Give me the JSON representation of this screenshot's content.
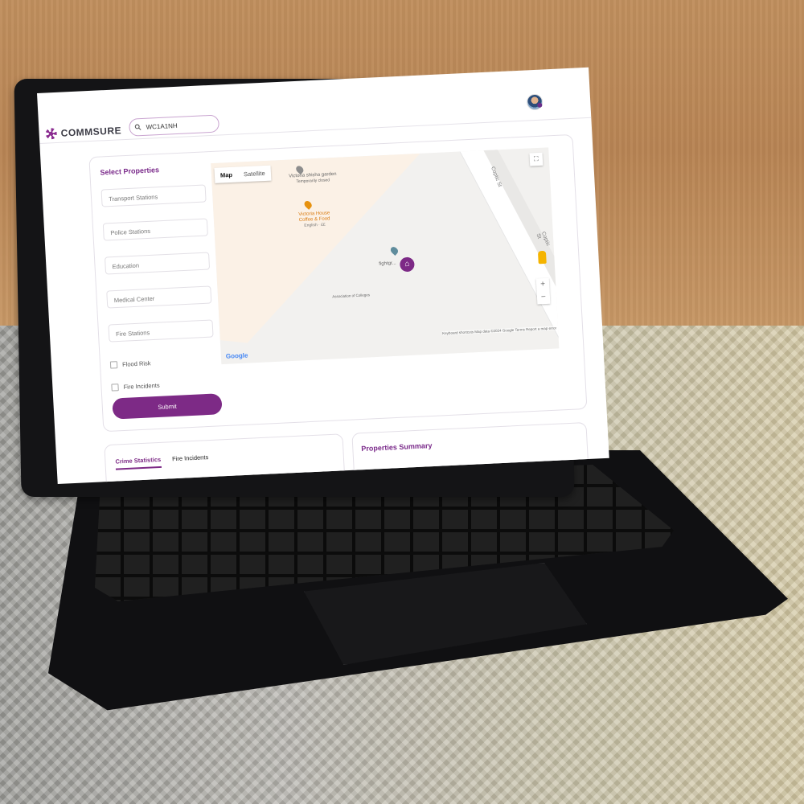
{
  "header": {
    "brand": "COMMSURE",
    "search_value": "WC1A1NH"
  },
  "select_panel": {
    "title": "Select Properties",
    "fields": [
      "Transport Stations",
      "Police Stations",
      "Education",
      "Medical Center",
      "Fire Stations"
    ],
    "checkboxes": [
      {
        "label": "Flood Risk",
        "checked": false
      },
      {
        "label": "Fire Incidents",
        "checked": false
      }
    ],
    "submit_label": "Submit"
  },
  "map": {
    "tabs": [
      "Map",
      "Satellite"
    ],
    "active_tab": "Map",
    "poi_garden": "Victoria shisha garden",
    "poi_garden_sub": "Temporarily closed",
    "poi_cafe": "Victoria House Coffee & Food",
    "poi_cafe_sub": "English · ££",
    "poi_nearby": "fightgr...",
    "poi_assoc": "Association of Colleges",
    "street": "Coptic St",
    "street2": "Coptic St",
    "google": "Google",
    "attribution": "Keyboard shortcuts   Map data ©2024 Google   Terms   Report a map error",
    "zoom_in": "+",
    "zoom_out": "−",
    "fullscreen_glyph": "⛶"
  },
  "crime_panel": {
    "tabs": [
      "Crime Statistics",
      "Fire Incidents"
    ],
    "active_tab": "Crime Statistics"
  },
  "summary_panel": {
    "title": "Properties Summary"
  },
  "colors": {
    "accent": "#7d2a86",
    "title": "#7a2a8a"
  }
}
